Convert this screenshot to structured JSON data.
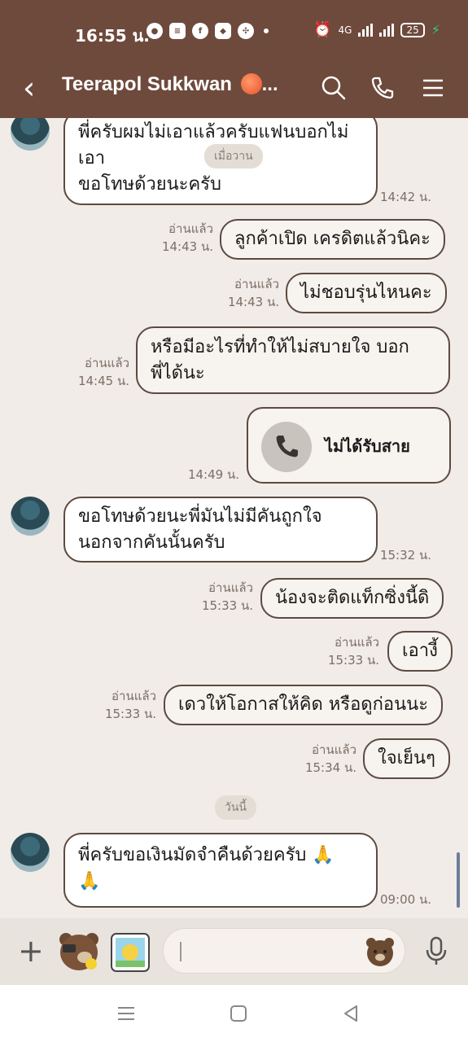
{
  "status_bar": {
    "time": "16:55 น.",
    "network": "4G",
    "battery": "25"
  },
  "header": {
    "title": "Teerapol Sukkwan",
    "title_suffix": "...",
    "colors": {
      "header_bg": "#6e4a3c"
    }
  },
  "chat": {
    "messages": [
      {
        "side": "in",
        "lines": [
          "พี่ครับผมไม่เอาแล้วครับแฟนบอกไม่",
          "เอา",
          "ขอโทษด้วยนะครับ"
        ],
        "time": "14:42 น."
      },
      {
        "side": "out",
        "text": "ลูกค้าเปิด เครดิตแล้วนิคะ",
        "read": "อ่านแล้ว",
        "time": "14:43 น."
      },
      {
        "side": "out",
        "text": "ไม่ชอบรุ่นไหนคะ",
        "read": "อ่านแล้ว",
        "time": "14:43 น."
      },
      {
        "side": "out",
        "lines": [
          "หรือมีอะไรที่ทำให้ไม่สบายใจ บอก",
          "พี่ได้นะ"
        ],
        "read": "อ่านแล้ว",
        "time": "14:45 น."
      },
      {
        "side": "out",
        "call": "ไม่ได้รับสาย",
        "time": "14:49 น."
      },
      {
        "side": "in",
        "lines": [
          "ขอโทษด้วยนะพี่มันไม่มีคันถูกใจ",
          "นอกจากคันนั้นครับ"
        ],
        "time": "15:32 น."
      },
      {
        "side": "out",
        "text": "น้องจะติดแท็กซิ่งนี้ดิ",
        "read": "อ่านแล้ว",
        "time": "15:33 น."
      },
      {
        "side": "out",
        "text": "เอางี้",
        "read": "อ่านแล้ว",
        "time": "15:33 น."
      },
      {
        "side": "out",
        "text": "เดวให้โอกาสให้คิด หรือดูก่อนนะ",
        "read": "อ่านแล้ว",
        "time": "15:33 น."
      },
      {
        "side": "out",
        "text": "ใจเย็นๆ",
        "read": "อ่านแล้ว",
        "time": "15:34 น."
      },
      {
        "side": "in",
        "lines": [
          "พี่ครับขอเงินมัดจำคืนด้วยครับ 🙏",
          "🙏"
        ],
        "time": "09:00 น."
      }
    ],
    "date_pills": {
      "yesterday": "เมื่อวาน",
      "today": "วันนี้"
    }
  },
  "colors": {
    "chat_bg": "#f1ece7",
    "bubble_border": "#5c4a40",
    "input_bar_bg": "#e9e3dd"
  }
}
